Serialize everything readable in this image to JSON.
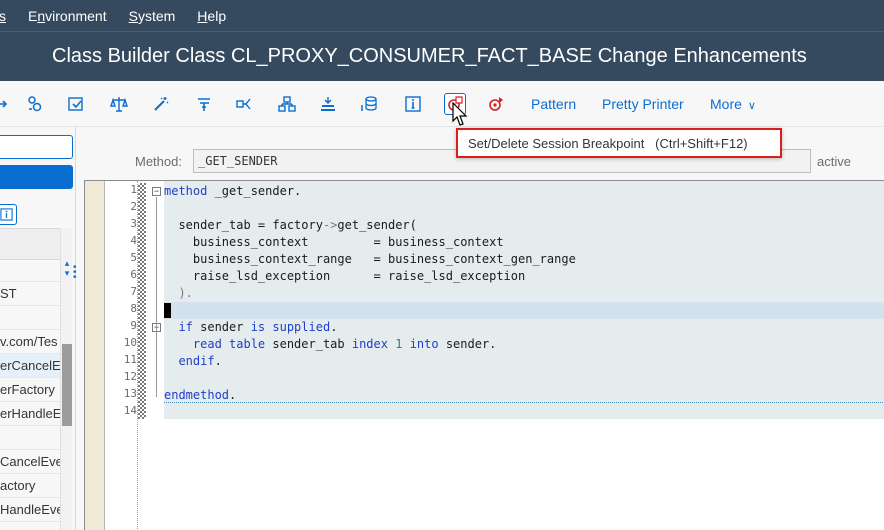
{
  "menu": {
    "items": [
      {
        "label": "s",
        "hot": "s",
        "rest": ""
      },
      {
        "label": "Environment",
        "hot": "n",
        "pre": "E",
        "rest": "vironment"
      },
      {
        "label": "System",
        "hot": "S",
        "pre": "",
        "rest": "ystem"
      },
      {
        "label": "Help",
        "hot": "H",
        "pre": "",
        "rest": "elp"
      }
    ]
  },
  "title": "Class Builder Class CL_PROXY_CONSUMER_FACT_BASE Change Enhancements",
  "toolbar": {
    "icons": [
      {
        "name": "arrow-partial-icon"
      },
      {
        "name": "objects-settings-icon"
      },
      {
        "name": "check-icon"
      },
      {
        "name": "balance-icon"
      },
      {
        "name": "magic-wand-icon"
      },
      {
        "name": "hierarchy-icon"
      },
      {
        "name": "where-used-icon"
      },
      {
        "name": "structure-icon"
      },
      {
        "name": "stack-icon"
      },
      {
        "name": "database-icon"
      },
      {
        "name": "info-icon"
      },
      {
        "name": "session-breakpoint-icon"
      },
      {
        "name": "external-breakpoint-icon"
      }
    ],
    "pattern_label": "Pattern",
    "pretty_printer_label": "Pretty Printer",
    "more_label": "More"
  },
  "tooltip": {
    "text": "Set/Delete Session Breakpoint   (Ctrl+Shift+F12)"
  },
  "left_pane": {
    "rows": [
      {
        "text": "",
        "selected": false
      },
      {
        "text": "ST",
        "selected": false
      },
      {
        "text": "",
        "selected": false
      },
      {
        "text": "v.com/Tes",
        "selected": false
      },
      {
        "text": "erCancelE",
        "selected": true
      },
      {
        "text": "erFactory",
        "selected": false
      },
      {
        "text": "erHandleE",
        "selected": false
      },
      {
        "text": "",
        "selected": false
      },
      {
        "text": "CancelEve",
        "selected": false
      },
      {
        "text": "actory",
        "selected": false
      },
      {
        "text": "HandleEve",
        "selected": false
      }
    ]
  },
  "method": {
    "label": "Method:",
    "value": "_GET_SENDER",
    "status": "active"
  },
  "editor": {
    "line_numbers": [
      "1",
      "2",
      "3",
      "4",
      "5",
      "6",
      "7",
      "8",
      "9",
      "10",
      "11",
      "12",
      "13",
      "14"
    ],
    "lines": [
      [
        {
          "t": "method",
          "c": "kw"
        },
        {
          "t": " _get_sender.",
          "c": ""
        }
      ],
      [],
      [
        {
          "t": "  sender_tab = factory",
          "c": ""
        },
        {
          "t": "->",
          "c": "op"
        },
        {
          "t": "get_sender(",
          "c": ""
        }
      ],
      [
        {
          "t": "    business_context         = business_context",
          "c": ""
        }
      ],
      [
        {
          "t": "    business_context_range   = business_context_gen_range",
          "c": ""
        }
      ],
      [
        {
          "t": "    raise_lsd_exception      = raise_lsd_exception",
          "c": ""
        }
      ],
      [
        {
          "t": "  ).",
          "c": "op"
        }
      ],
      [],
      [
        {
          "t": "  ",
          "c": ""
        },
        {
          "t": "if",
          "c": "kw"
        },
        {
          "t": " sender ",
          "c": ""
        },
        {
          "t": "is supplied",
          "c": "kw"
        },
        {
          "t": ".",
          "c": ""
        }
      ],
      [
        {
          "t": "    ",
          "c": ""
        },
        {
          "t": "read table",
          "c": "kw"
        },
        {
          "t": " sender_tab ",
          "c": ""
        },
        {
          "t": "index",
          "c": "kw"
        },
        {
          "t": " ",
          "c": ""
        },
        {
          "t": "1",
          "c": "num"
        },
        {
          "t": " ",
          "c": ""
        },
        {
          "t": "into",
          "c": "kw"
        },
        {
          "t": " sender.",
          "c": ""
        }
      ],
      [
        {
          "t": "  ",
          "c": ""
        },
        {
          "t": "endif",
          "c": "kw"
        },
        {
          "t": ".",
          "c": ""
        }
      ],
      [],
      [
        {
          "t": "endmethod",
          "c": "kw"
        },
        {
          "t": ".",
          "c": ""
        }
      ],
      []
    ]
  },
  "colors": {
    "shell": "#354a5f",
    "accent": "#0a6ed1",
    "highlight_border": "#d81f1f",
    "keyword": "#1f3ec9"
  }
}
